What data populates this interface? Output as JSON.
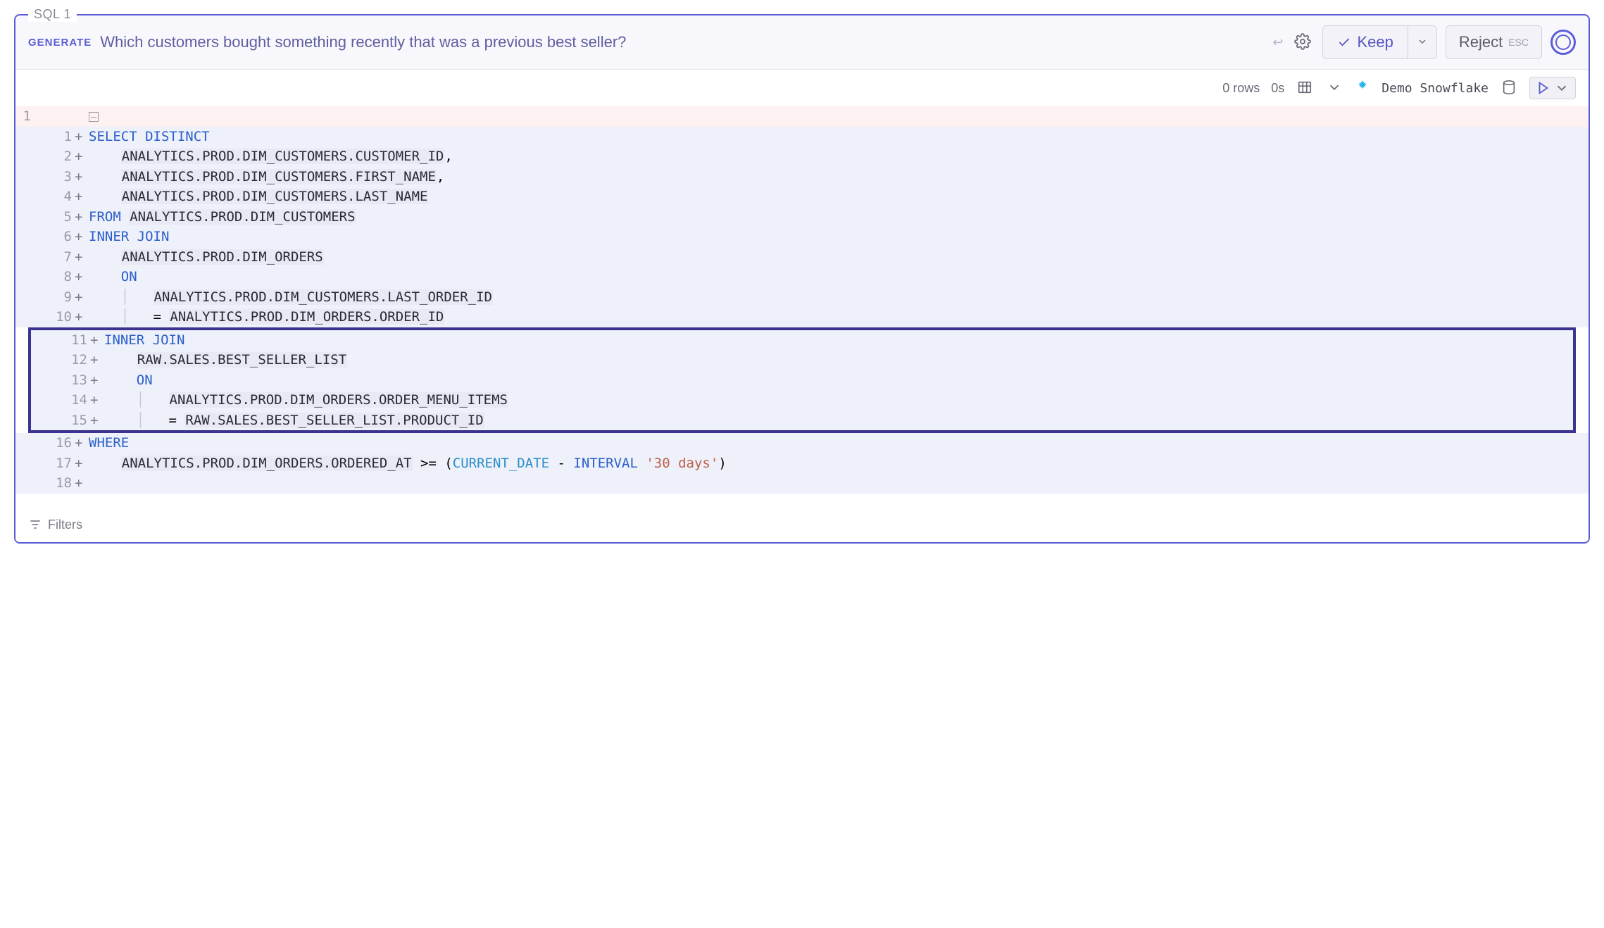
{
  "tab": {
    "label": "SQL 1"
  },
  "toolbar": {
    "generate_label": "GENERATE",
    "prompt": "Which customers bought something recently that was a previous best seller?",
    "keep_label": "Keep",
    "reject_label": "Reject",
    "reject_hint": "ESC"
  },
  "status": {
    "rows": "0 rows",
    "time": "0s",
    "datasource": "Demo Snowflake"
  },
  "editor": {
    "outer_line": "1",
    "lines": [
      {
        "n": 1,
        "bg": "blue",
        "segments": [
          {
            "t": "SELECT DISTINCT",
            "c": "kw"
          }
        ]
      },
      {
        "n": 2,
        "bg": "blue",
        "segments": [
          {
            "t": "    ",
            "c": ""
          },
          {
            "t": "ANALYTICS.PROD.DIM_CUSTOMERS.CUSTOMER_ID",
            "c": "ident"
          },
          {
            "t": ",",
            "c": ""
          }
        ]
      },
      {
        "n": 3,
        "bg": "blue",
        "segments": [
          {
            "t": "    ",
            "c": ""
          },
          {
            "t": "ANALYTICS.PROD.DIM_CUSTOMERS.FIRST_NAME",
            "c": "ident"
          },
          {
            "t": ",",
            "c": ""
          }
        ]
      },
      {
        "n": 4,
        "bg": "blue",
        "segments": [
          {
            "t": "    ",
            "c": ""
          },
          {
            "t": "ANALYTICS.PROD.DIM_CUSTOMERS.LAST_NAME",
            "c": "ident"
          }
        ]
      },
      {
        "n": 5,
        "bg": "blue",
        "segments": [
          {
            "t": "FROM",
            "c": "kw"
          },
          {
            "t": " ",
            "c": ""
          },
          {
            "t": "ANALYTICS.PROD.DIM_CUSTOMERS",
            "c": "ident"
          }
        ]
      },
      {
        "n": 6,
        "bg": "blue",
        "segments": [
          {
            "t": "INNER JOIN",
            "c": "kw"
          }
        ]
      },
      {
        "n": 7,
        "bg": "blue",
        "segments": [
          {
            "t": "    ",
            "c": ""
          },
          {
            "t": "ANALYTICS.PROD.DIM_ORDERS",
            "c": "ident"
          }
        ]
      },
      {
        "n": 8,
        "bg": "blue",
        "segments": [
          {
            "t": "    ",
            "c": ""
          },
          {
            "t": "ON",
            "c": "kw"
          }
        ]
      },
      {
        "n": 9,
        "bg": "blue",
        "segments": [
          {
            "t": "    ",
            "c": ""
          },
          {
            "t": "│   ",
            "c": "guide"
          },
          {
            "t": "ANALYTICS.PROD.DIM_CUSTOMERS.LAST_ORDER_ID",
            "c": "ident"
          }
        ]
      },
      {
        "n": 10,
        "bg": "blue",
        "segments": [
          {
            "t": "    ",
            "c": ""
          },
          {
            "t": "│   ",
            "c": "guide"
          },
          {
            "t": "= ",
            "c": ""
          },
          {
            "t": "ANALYTICS.PROD.DIM_ORDERS.ORDER_ID",
            "c": "ident"
          }
        ]
      },
      {
        "n": 11,
        "bg": "blue",
        "hl": true,
        "segments": [
          {
            "t": "INNER JOIN",
            "c": "kw"
          }
        ]
      },
      {
        "n": 12,
        "bg": "blue",
        "hl": true,
        "segments": [
          {
            "t": "    ",
            "c": ""
          },
          {
            "t": "RAW.SALES.BEST_SELLER_LIST",
            "c": "ident"
          }
        ]
      },
      {
        "n": 13,
        "bg": "blue",
        "hl": true,
        "segments": [
          {
            "t": "    ",
            "c": ""
          },
          {
            "t": "ON",
            "c": "kw"
          }
        ]
      },
      {
        "n": 14,
        "bg": "blue",
        "hl": true,
        "segments": [
          {
            "t": "    ",
            "c": ""
          },
          {
            "t": "│   ",
            "c": "guide"
          },
          {
            "t": "ANALYTICS.PROD.DIM_ORDERS.ORDER_MENU_ITEMS",
            "c": "ident"
          }
        ]
      },
      {
        "n": 15,
        "bg": "blue",
        "hl": true,
        "segments": [
          {
            "t": "    ",
            "c": ""
          },
          {
            "t": "│   ",
            "c": "guide"
          },
          {
            "t": "= ",
            "c": ""
          },
          {
            "t": "RAW.SALES.BEST_SELLER_LIST.PRODUCT_ID",
            "c": "ident"
          }
        ]
      },
      {
        "n": 16,
        "bg": "blue",
        "segments": [
          {
            "t": "WHERE",
            "c": "kw"
          }
        ]
      },
      {
        "n": 17,
        "bg": "blue",
        "segments": [
          {
            "t": "    ",
            "c": ""
          },
          {
            "t": "ANALYTICS.PROD.DIM_ORDERS.ORDERED_AT",
            "c": "ident"
          },
          {
            "t": " >= (",
            "c": ""
          },
          {
            "t": "CURRENT_DATE",
            "c": "func"
          },
          {
            "t": " - ",
            "c": ""
          },
          {
            "t": "INTERVAL",
            "c": "kw"
          },
          {
            "t": " ",
            "c": ""
          },
          {
            "t": "'30 days'",
            "c": "str"
          },
          {
            "t": ")",
            "c": ""
          }
        ]
      },
      {
        "n": 18,
        "bg": "blue",
        "segments": []
      }
    ]
  },
  "footer": {
    "filters_label": "Filters"
  }
}
